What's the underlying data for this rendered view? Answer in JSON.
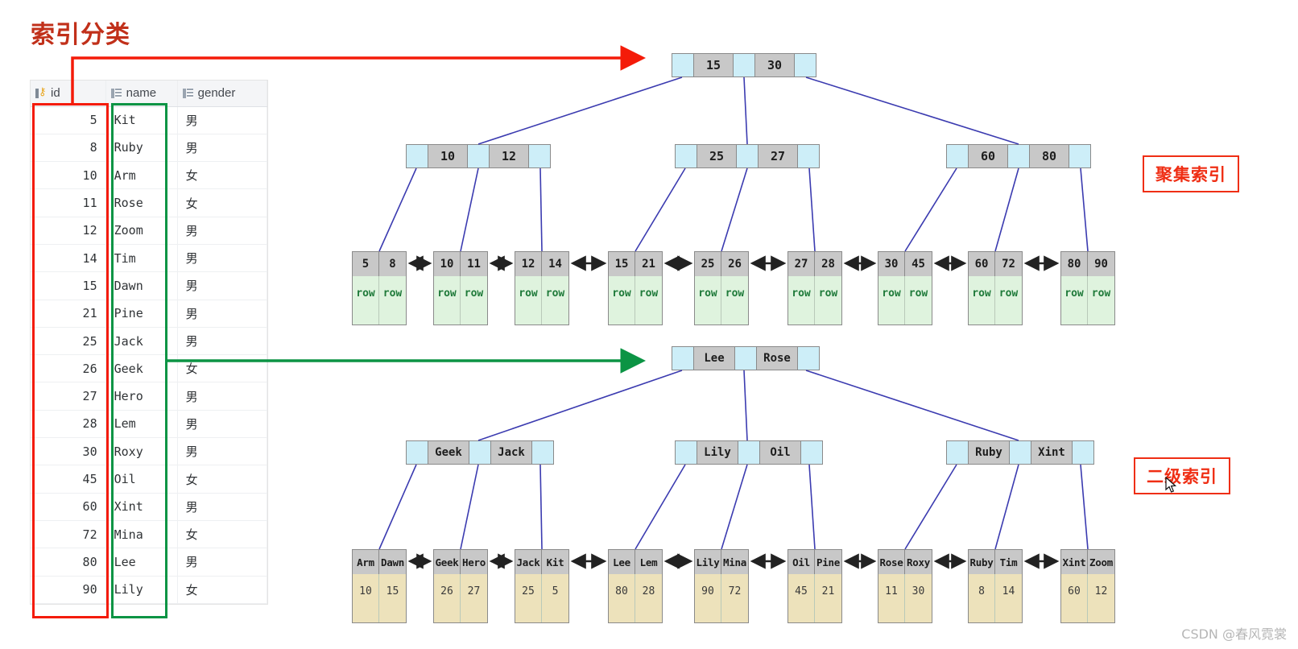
{
  "page": {
    "title": "索引分类",
    "watermark": "CSDN @春风霓裳"
  },
  "table": {
    "columns": [
      {
        "key": "id",
        "label": "id",
        "icon": "primary-key-icon"
      },
      {
        "key": "name",
        "label": "name",
        "icon": "column-grid-icon"
      },
      {
        "key": "gender",
        "label": "gender",
        "icon": "column-grid-icon"
      }
    ],
    "rows": [
      {
        "id": "5",
        "name": "Kit",
        "gender": "男"
      },
      {
        "id": "8",
        "name": "Ruby",
        "gender": "男"
      },
      {
        "id": "10",
        "name": "Arm",
        "gender": "女"
      },
      {
        "id": "11",
        "name": "Rose",
        "gender": "女"
      },
      {
        "id": "12",
        "name": "Zoom",
        "gender": "男"
      },
      {
        "id": "14",
        "name": "Tim",
        "gender": "男"
      },
      {
        "id": "15",
        "name": "Dawn",
        "gender": "男"
      },
      {
        "id": "21",
        "name": "Pine",
        "gender": "男"
      },
      {
        "id": "25",
        "name": "Jack",
        "gender": "男"
      },
      {
        "id": "26",
        "name": "Geek",
        "gender": "女"
      },
      {
        "id": "27",
        "name": "Hero",
        "gender": "男"
      },
      {
        "id": "28",
        "name": "Lem",
        "gender": "男"
      },
      {
        "id": "30",
        "name": "Roxy",
        "gender": "男"
      },
      {
        "id": "45",
        "name": "Oil",
        "gender": "女"
      },
      {
        "id": "60",
        "name": "Xint",
        "gender": "男"
      },
      {
        "id": "72",
        "name": "Mina",
        "gender": "女"
      },
      {
        "id": "80",
        "name": "Lee",
        "gender": "男"
      },
      {
        "id": "90",
        "name": "Lily",
        "gender": "女"
      }
    ],
    "highlights": {
      "id_column_color": "#f41b09",
      "name_column_color": "#0b9444"
    }
  },
  "annotations": {
    "clustered_label": "聚集索引",
    "secondary_label": "二级索引",
    "label_color": "#ef2e14",
    "id_arrow_color": "#f41b09",
    "name_arrow_color": "#0b9444",
    "connector_color": "#3b3bb0"
  },
  "clustered_index": {
    "name": "聚集索引",
    "root": {
      "keys": [
        "15",
        "30"
      ]
    },
    "internal": [
      {
        "keys": [
          "10",
          "12"
        ]
      },
      {
        "keys": [
          "25",
          "27"
        ]
      },
      {
        "keys": [
          "60",
          "80"
        ]
      }
    ],
    "leaves": [
      {
        "keys": [
          "5",
          "8"
        ],
        "values": [
          "row",
          "row"
        ]
      },
      {
        "keys": [
          "10",
          "11"
        ],
        "values": [
          "row",
          "row"
        ]
      },
      {
        "keys": [
          "12",
          "14"
        ],
        "values": [
          "row",
          "row"
        ]
      },
      {
        "keys": [
          "15",
          "21"
        ],
        "values": [
          "row",
          "row"
        ]
      },
      {
        "keys": [
          "25",
          "26"
        ],
        "values": [
          "row",
          "row"
        ]
      },
      {
        "keys": [
          "27",
          "28"
        ],
        "values": [
          "row",
          "row"
        ]
      },
      {
        "keys": [
          "30",
          "45"
        ],
        "values": [
          "row",
          "row"
        ]
      },
      {
        "keys": [
          "60",
          "72"
        ],
        "values": [
          "row",
          "row"
        ]
      },
      {
        "keys": [
          "80",
          "90"
        ],
        "values": [
          "row",
          "row"
        ]
      }
    ]
  },
  "secondary_index": {
    "name": "二级索引",
    "root": {
      "keys": [
        "Lee",
        "Rose"
      ]
    },
    "internal": [
      {
        "keys": [
          "Geek",
          "Jack"
        ]
      },
      {
        "keys": [
          "Lily",
          "Oil"
        ]
      },
      {
        "keys": [
          "Ruby",
          "Xint"
        ]
      }
    ],
    "leaves": [
      {
        "keys": [
          "Arm",
          "Dawn"
        ],
        "values": [
          "10",
          "15"
        ]
      },
      {
        "keys": [
          "Geek",
          "Hero"
        ],
        "values": [
          "26",
          "27"
        ]
      },
      {
        "keys": [
          "Jack",
          "Kit"
        ],
        "values": [
          "25",
          "5"
        ]
      },
      {
        "keys": [
          "Lee",
          "Lem"
        ],
        "values": [
          "80",
          "28"
        ]
      },
      {
        "keys": [
          "Lily",
          "Mina"
        ],
        "values": [
          "90",
          "72"
        ]
      },
      {
        "keys": [
          "Oil",
          "Pine"
        ],
        "values": [
          "45",
          "21"
        ]
      },
      {
        "keys": [
          "Rose",
          "Roxy"
        ],
        "values": [
          "11",
          "30"
        ]
      },
      {
        "keys": [
          "Ruby",
          "Tim"
        ],
        "values": [
          "8",
          "14"
        ]
      },
      {
        "keys": [
          "Xint",
          "Zoom"
        ],
        "values": [
          "60",
          "12"
        ]
      }
    ]
  }
}
